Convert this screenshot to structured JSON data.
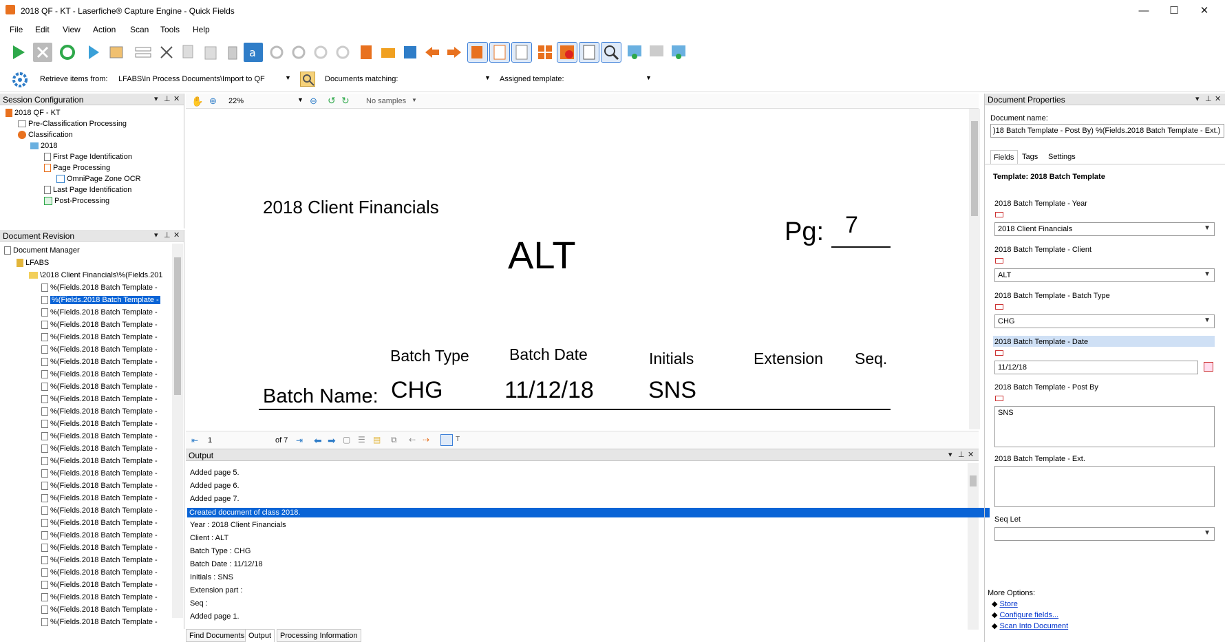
{
  "window": {
    "title": "2018 QF - KT - Laserfiche® Capture Engine - Quick Fields",
    "minimize": "—",
    "maximize": "☐",
    "close": "✕"
  },
  "menu": [
    "File",
    "Edit",
    "View",
    "Action",
    "Scan",
    "Tools",
    "Help"
  ],
  "retrieve": {
    "label": "Retrieve items from:",
    "value": "LFABS\\In Process Documents\\Import to QF",
    "docs_matching_label": "Documents matching:",
    "docs_matching_value": "",
    "assigned_template_label": "Assigned template:",
    "assigned_template_value": ""
  },
  "session_config": {
    "title": "Session Configuration",
    "items": [
      {
        "label": "2018 QF - KT"
      },
      {
        "label": "Pre-Classification Processing"
      },
      {
        "label": "Classification"
      },
      {
        "label": "2018"
      },
      {
        "label": "First Page Identification"
      },
      {
        "label": "Page Processing"
      },
      {
        "label": "OmniPage Zone OCR"
      },
      {
        "label": "Last Page Identification"
      },
      {
        "label": "Post-Processing"
      }
    ]
  },
  "doc_revision": {
    "title": "Document Revision",
    "root": "Document Manager",
    "repo": "LFABS",
    "folder": "\\2018 Client Financials\\%(Fields.201",
    "doc_label": "%(Fields.2018 Batch Template -",
    "doc_count": 28,
    "selected_index": 1
  },
  "viewer": {
    "zoom": "22%",
    "samples": "No samples",
    "page": "1",
    "of_pages": "of 7",
    "doc": {
      "heading": "2018 Client Financials",
      "pg_label": "Pg:",
      "pg_value": "7",
      "client": "ALT",
      "col_batch_type": "Batch Type",
      "col_batch_date": "Batch Date",
      "col_initials": "Initials",
      "col_extension": "Extension",
      "col_seq": "Seq.",
      "batch_name_label": "Batch Name:",
      "val_batch_type": "CHG",
      "val_batch_date": "11/12/18",
      "val_initials": "SNS"
    }
  },
  "output": {
    "title": "Output",
    "lines": [
      "Added page 5.",
      "Added page 6.",
      "Added page 7.",
      "Created document of class 2018.",
      "Year : 2018 Client Financials",
      "Client : ALT",
      "Batch Type : CHG",
      "Batch Date : 11/12/18",
      "Initials : SNS",
      "Extension part :",
      "Seq :",
      "Added page 1."
    ],
    "selected_index": 3
  },
  "bottom_tabs": [
    "Find Documents",
    "Output",
    "Processing Information"
  ],
  "doc_props": {
    "title": "Document Properties",
    "doc_name_label": "Document name:",
    "doc_name_value": ")18 Batch Template - Post By) %(Fields.2018 Batch Template - Ext.)",
    "tabs": [
      "Fields",
      "Tags",
      "Settings"
    ],
    "template": "Template: 2018 Batch Template",
    "fields": {
      "year_label": "2018 Batch Template - Year",
      "year_value": "2018 Client Financials",
      "client_label": "2018 Batch Template - Client",
      "client_value": "ALT",
      "batch_type_label": "2018 Batch Template - Batch Type",
      "batch_type_value": "CHG",
      "date_label": "2018 Batch Template - Date",
      "date_value": "11/12/18",
      "post_by_label": "2018 Batch Template - Post By",
      "post_by_value": "SNS",
      "ext_label": "2018 Batch Template - Ext.",
      "ext_value": "",
      "seq_let_label": "Seq Let",
      "seq_let_value": ""
    },
    "more_options_label": "More Options:",
    "options": [
      "Store",
      "Configure fields...",
      "Scan Into Document"
    ]
  },
  "colors": {
    "selection": "#0a64d6",
    "panel_header": "#e6e6e6",
    "field_highlight": "#cfe0f5",
    "accent_orange": "#e8711f"
  }
}
